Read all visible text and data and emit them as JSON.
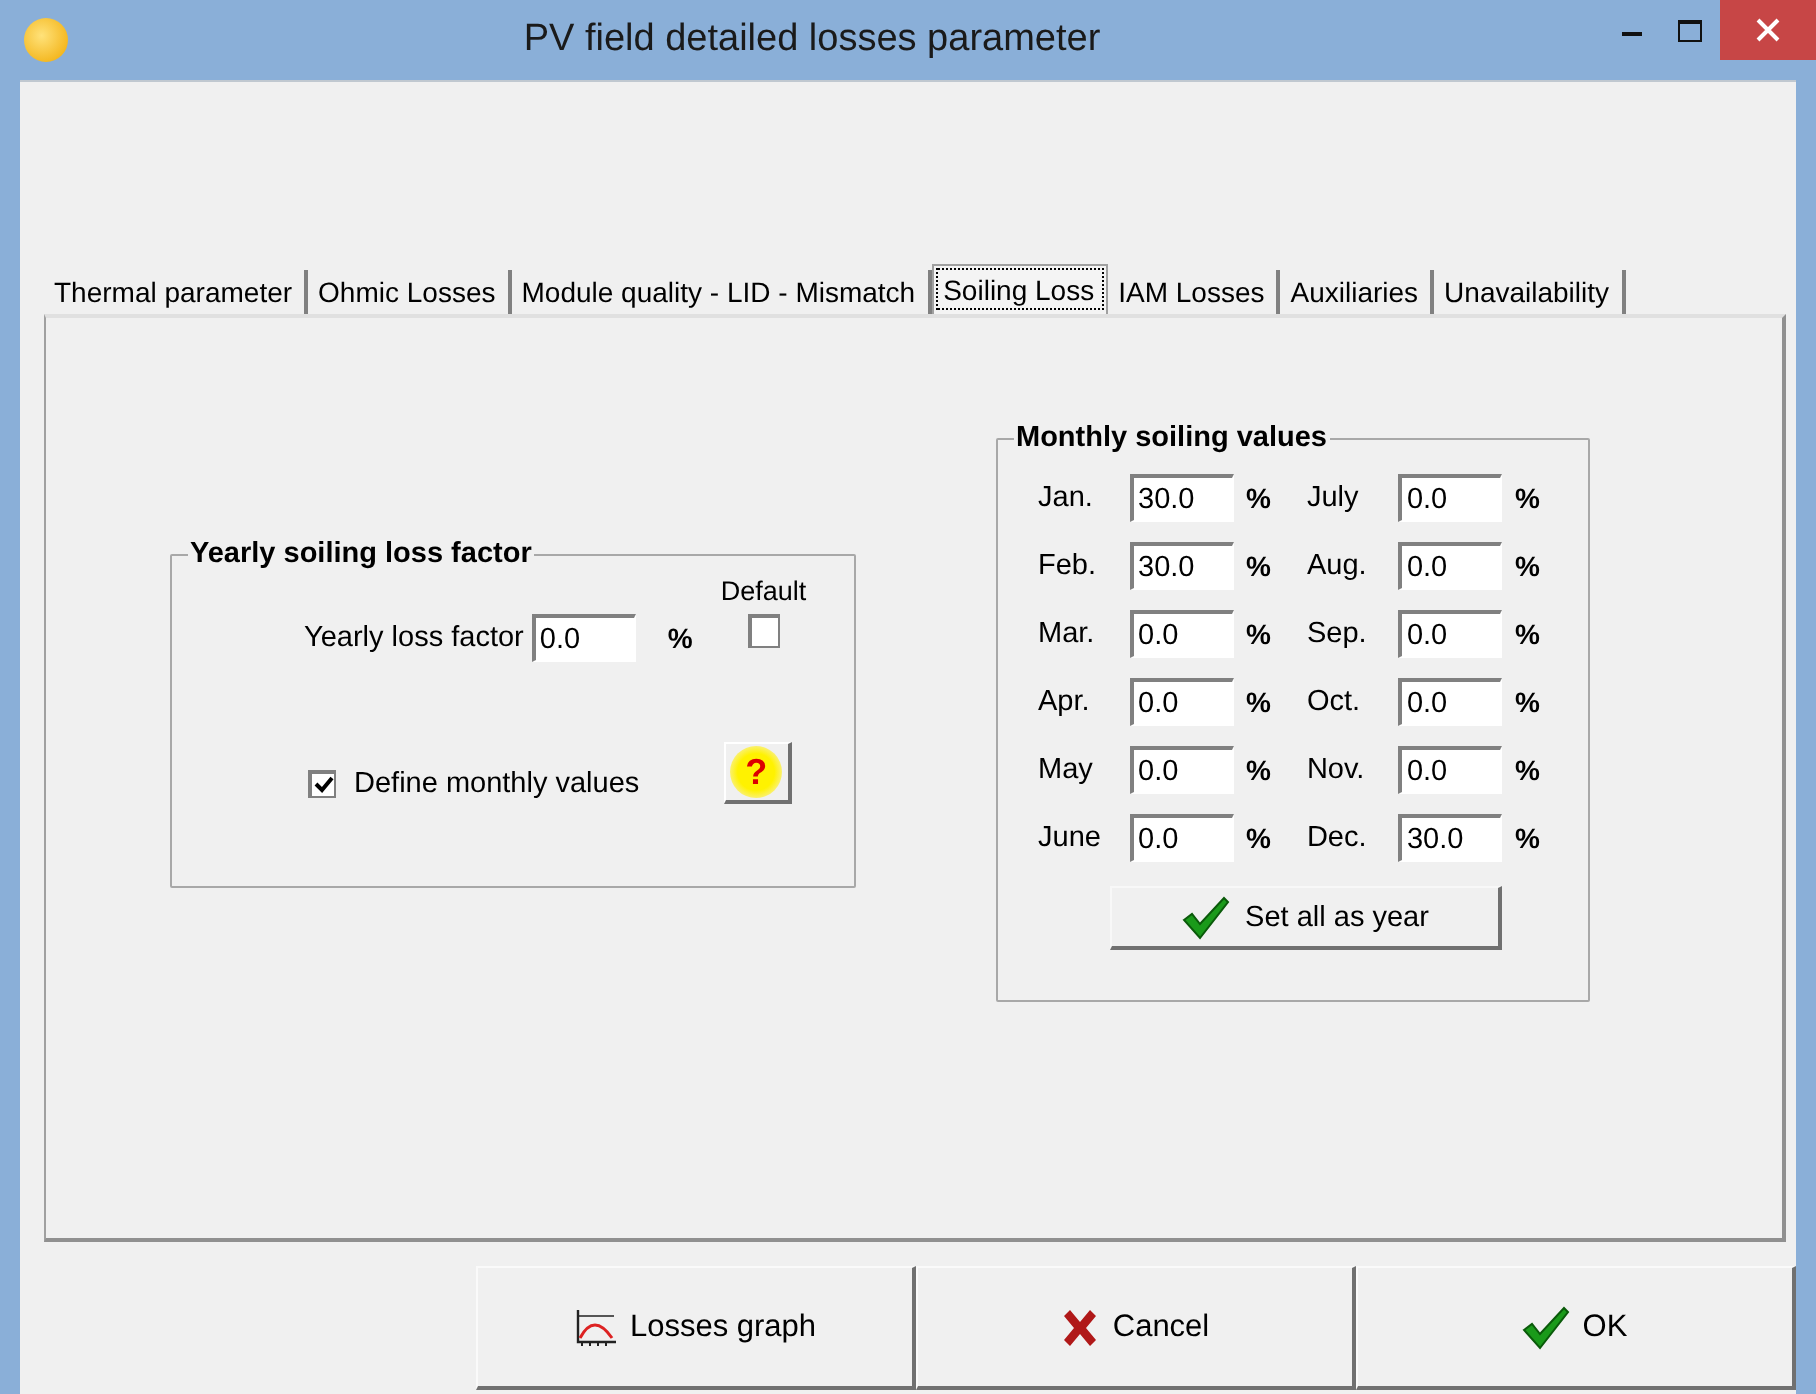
{
  "window": {
    "title": "PV field detailed losses parameter"
  },
  "tabs": [
    {
      "label": "Thermal parameter",
      "selected": false
    },
    {
      "label": "Ohmic Losses",
      "selected": false
    },
    {
      "label": "Module quality - LID - Mismatch",
      "selected": false
    },
    {
      "label": "Soiling Loss",
      "selected": true
    },
    {
      "label": "IAM Losses",
      "selected": false
    },
    {
      "label": "Auxiliaries",
      "selected": false
    },
    {
      "label": "Unavailability",
      "selected": false
    }
  ],
  "yearly": {
    "title": "Yearly soiling loss factor",
    "label": "Yearly loss factor",
    "value": "0.0",
    "unit": "%",
    "default_label": "Default",
    "default_checked": false,
    "monthly_label": "Define monthly values",
    "monthly_checked": true,
    "help": "?"
  },
  "monthly": {
    "title": "Monthly soiling values",
    "months": [
      {
        "label": "Jan.",
        "value": "30.0",
        "unit": "%"
      },
      {
        "label": "July",
        "value": "0.0",
        "unit": "%"
      },
      {
        "label": "Feb.",
        "value": "30.0",
        "unit": "%"
      },
      {
        "label": "Aug.",
        "value": "0.0",
        "unit": "%"
      },
      {
        "label": "Mar.",
        "value": "0.0",
        "unit": "%"
      },
      {
        "label": "Sep.",
        "value": "0.0",
        "unit": "%"
      },
      {
        "label": "Apr.",
        "value": "0.0",
        "unit": "%"
      },
      {
        "label": "Oct.",
        "value": "0.0",
        "unit": "%"
      },
      {
        "label": "May",
        "value": "0.0",
        "unit": "%"
      },
      {
        "label": "Nov.",
        "value": "0.0",
        "unit": "%"
      },
      {
        "label": "June",
        "value": "0.0",
        "unit": "%"
      },
      {
        "label": "Dec.",
        "value": "30.0",
        "unit": "%"
      }
    ],
    "set_button": "Set all as year"
  },
  "buttons": [
    {
      "kind": "graph",
      "label": "Losses graph"
    },
    {
      "kind": "cancel",
      "label": "Cancel"
    },
    {
      "kind": "ok",
      "label": "OK"
    }
  ]
}
